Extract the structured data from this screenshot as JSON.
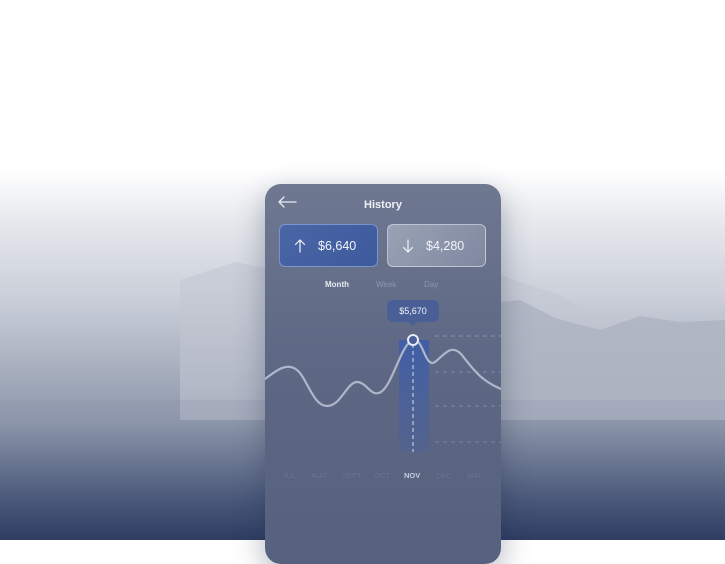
{
  "header": {
    "title": "History"
  },
  "summary": {
    "income": {
      "amount": "$6,640",
      "icon": "arrow-up-icon"
    },
    "expense": {
      "amount": "$4,280",
      "icon": "arrow-down-icon"
    }
  },
  "tabs": [
    "Month",
    "Week",
    "Day"
  ],
  "active_tab": "Month",
  "tooltip": {
    "value": "$5,670"
  },
  "months": [
    "JUL",
    "AUG",
    "SEPT",
    "OCT",
    "NOV",
    "DEC",
    "JAN"
  ],
  "active_month": "NOV",
  "colors": {
    "accent": "#4a66a6",
    "card_background": "#5e6884",
    "line": "#aeb6c9"
  }
}
